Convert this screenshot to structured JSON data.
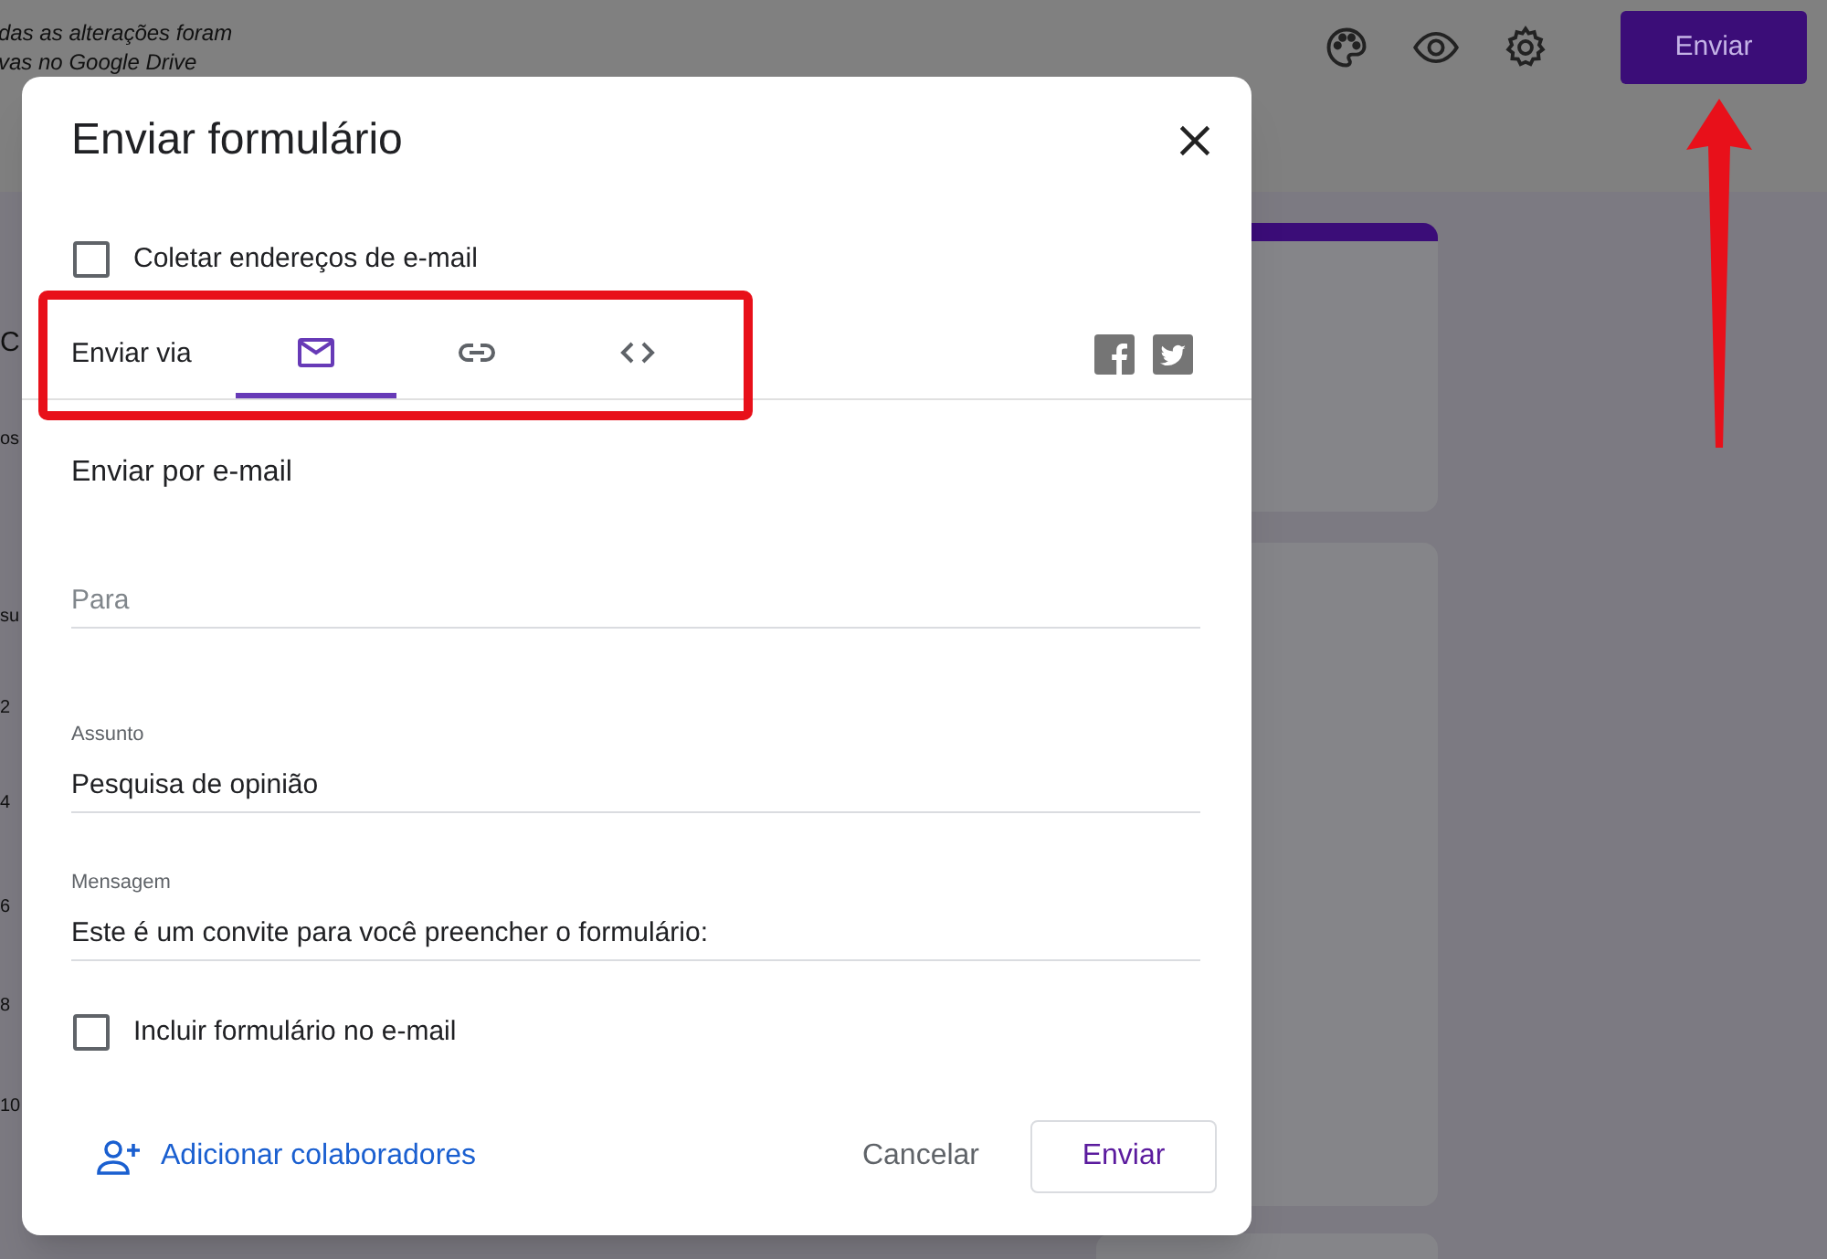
{
  "background": {
    "autosave_note": [
      "das as alterações foram",
      "vas no Google Drive"
    ],
    "send_button": "Enviar",
    "left_fragments": [
      "C",
      "os",
      "su",
      "2",
      "4",
      "6",
      "8",
      "10"
    ]
  },
  "dialog": {
    "title": "Enviar formulário",
    "collect_emails": {
      "label": "Coletar endereços de e-mail",
      "checked": false
    },
    "send_via": {
      "label": "Enviar via",
      "tabs": [
        {
          "kind": "email",
          "selected": true
        },
        {
          "kind": "link",
          "selected": false
        },
        {
          "kind": "embed",
          "selected": false
        }
      ]
    },
    "section_title": "Enviar por e-mail",
    "fields": [
      {
        "placeholder": "Para"
      },
      {
        "label": "Assunto",
        "value": "Pesquisa de opinião"
      },
      {
        "label": "Mensagem",
        "value": "Este é um convite para você preencher o formulário:"
      }
    ],
    "include_form": {
      "label": "Incluir formulário no e-mail",
      "checked": false
    },
    "add_collaborators": "Adicionar colaboradores",
    "buttons": [
      "Cancelar",
      "Enviar"
    ]
  }
}
